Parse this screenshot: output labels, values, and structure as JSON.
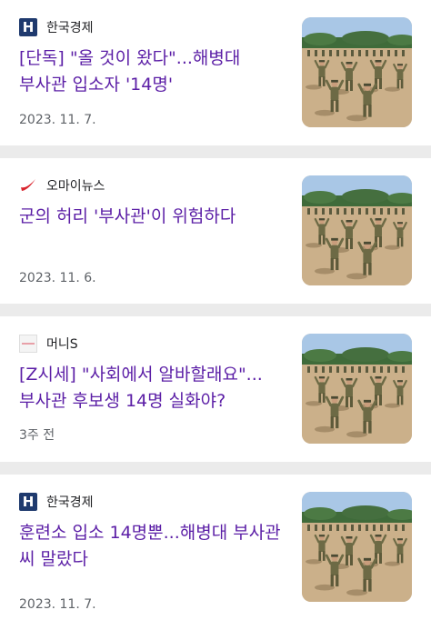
{
  "articles": [
    {
      "source": "한국경제",
      "logo_icon": "hankyung-logo-icon",
      "logo_letter": "H",
      "headline": "[단독] \"올 것이 왔다\"...해병대 부사관 입소자 '14명'",
      "date": "2023. 11. 7."
    },
    {
      "source": "오마이뉴스",
      "logo_icon": "ohmynews-logo-icon",
      "logo_letter": "",
      "headline": "군의 허리 '부사관'이 위험하다",
      "date": "2023. 11. 6."
    },
    {
      "source": "머니S",
      "logo_icon": "moneys-logo-icon",
      "logo_letter": "",
      "headline": "[Z시세] \"사회에서 알바할래요\"... 부사관 후보생 14명 실화야?",
      "date": "3주 전"
    },
    {
      "source": "한국경제",
      "logo_icon": "hankyung-logo-icon",
      "logo_letter": "H",
      "headline": "훈련소 입소 14명뿐...해병대 부사관 씨 말랐다",
      "date": "2023. 11. 7."
    }
  ],
  "colors": {
    "headline": "#5b1ea6",
    "hankyung_logo": "#1f3a6e",
    "ohmynews_logo": "#d9232d"
  }
}
